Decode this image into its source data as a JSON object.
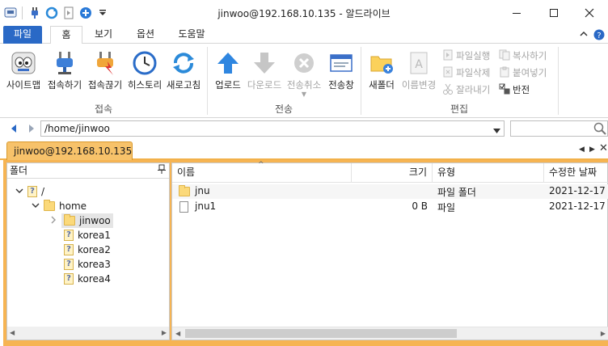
{
  "window": {
    "title": "jinwoo@192.168.10.135 - 알드라이브"
  },
  "ribbon_tabs": [
    "파일",
    "홈",
    "보기",
    "옵션",
    "도움말"
  ],
  "groups": {
    "connect": {
      "label": "접속",
      "buttons": [
        "사이트맵",
        "접속하기",
        "접속끊기",
        "히스토리",
        "새로고침"
      ]
    },
    "transfer": {
      "label": "전송",
      "buttons": [
        "업로드",
        "다운로드",
        "전송취소",
        "전송창"
      ]
    },
    "edit": {
      "label": "편집",
      "big_buttons": [
        "새폴더",
        "이름변경"
      ],
      "small_buttons": [
        "파일실행",
        "파일삭제",
        "잘라내기",
        "복사하기",
        "붙여넣기",
        "반전"
      ]
    }
  },
  "address": {
    "path": "/home/jinwoo",
    "search_value": ""
  },
  "session_tab": "jinwoo@192.168.10.135",
  "folder_panel": {
    "title": "폴더",
    "pin": "ㅁ",
    "tree": [
      "/",
      "home",
      "jinwoo",
      "korea1",
      "korea2",
      "korea3",
      "korea4"
    ]
  },
  "file_list": {
    "columns": [
      "이름",
      "크기",
      "유형",
      "수정한 날짜"
    ],
    "rows": [
      {
        "name": "jnu",
        "size": "",
        "type": "파일 폴더",
        "date": "2021-12-17"
      },
      {
        "name": "jnu1",
        "size": "0 B",
        "type": "파일",
        "date": "2021-12-17"
      }
    ]
  },
  "colors": {
    "file_tab": "#2a69c6",
    "session_tab": "#f7c26a",
    "panel_border": "#f6b453"
  }
}
